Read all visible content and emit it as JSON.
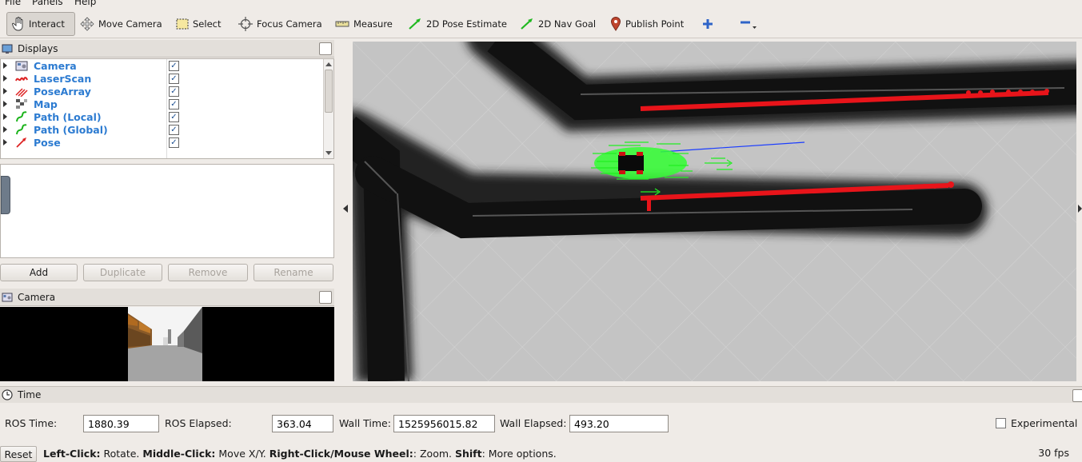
{
  "menu": [
    "File",
    "Panels",
    "Help"
  ],
  "toolbar": {
    "interact": "Interact",
    "move_camera": "Move Camera",
    "select": "Select",
    "focus_camera": "Focus Camera",
    "measure": "Measure",
    "pose_estimate": "2D Pose Estimate",
    "nav_goal": "2D Nav Goal",
    "publish_point": "Publish Point"
  },
  "displays_panel": {
    "title": "Displays",
    "items": [
      {
        "label": "Camera",
        "icon": "camera-icon",
        "checked": true
      },
      {
        "label": "LaserScan",
        "icon": "laserscan-icon",
        "checked": true
      },
      {
        "label": "PoseArray",
        "icon": "posearray-icon",
        "checked": true
      },
      {
        "label": "Map",
        "icon": "map-icon",
        "checked": true
      },
      {
        "label": "Path (Local)",
        "icon": "path-icon",
        "checked": true
      },
      {
        "label": "Path (Global)",
        "icon": "path-icon",
        "checked": true
      },
      {
        "label": "Pose",
        "icon": "pose-icon",
        "checked": true
      }
    ],
    "buttons": {
      "add": "Add",
      "duplicate": "Duplicate",
      "remove": "Remove",
      "rename": "Rename"
    }
  },
  "camera_panel": {
    "title": "Camera"
  },
  "time_panel": {
    "title": "Time",
    "ros_time_label": "ROS Time:",
    "ros_time": "1880.39",
    "ros_elapsed_label": "ROS Elapsed:",
    "ros_elapsed": "363.04",
    "wall_time_label": "Wall Time:",
    "wall_time": "1525956015.82",
    "wall_elapsed_label": "Wall Elapsed:",
    "wall_elapsed": "493.20",
    "experimental_label": "Experimental"
  },
  "status_bar": {
    "reset": "Reset",
    "left_click": "Left-Click:",
    "left_click_desc": " Rotate. ",
    "middle_click": "Middle-Click:",
    "middle_click_desc": " Move X/Y. ",
    "right_click": "Right-Click/Mouse Wheel:",
    "right_click_desc": ": Zoom. ",
    "shift": "Shift",
    "shift_desc": ": More options.",
    "fps": "30 fps"
  },
  "colors": {
    "laser": "#e8141a",
    "pose_array": "#22ee22",
    "path_global": "#1a3cff",
    "link": "#2c7bd1"
  }
}
